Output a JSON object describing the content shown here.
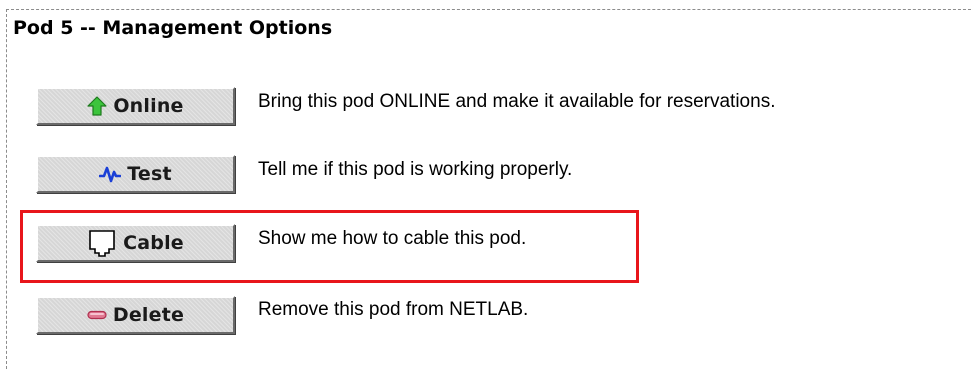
{
  "page": {
    "title": "Pod 5 -- Management Options"
  },
  "options": [
    {
      "button_label": "Online",
      "icon": "up-arrow-icon",
      "description": "Bring this pod ONLINE and make it available for reservations."
    },
    {
      "button_label": "Test",
      "icon": "pulse-icon",
      "description": "Tell me if this pod is working properly."
    },
    {
      "button_label": "Cable",
      "icon": "cable-jack-icon",
      "description": "Show me how to cable this pod."
    },
    {
      "button_label": "Delete",
      "icon": "minus-pill-icon",
      "description": "Remove this pod from NETLAB."
    }
  ],
  "colors": {
    "highlight_border": "#e8161b",
    "button_face": "#d6d6d6",
    "online_icon": "#2fb52f",
    "test_icon": "#1a3fd6",
    "delete_icon": "#d94b6a"
  }
}
